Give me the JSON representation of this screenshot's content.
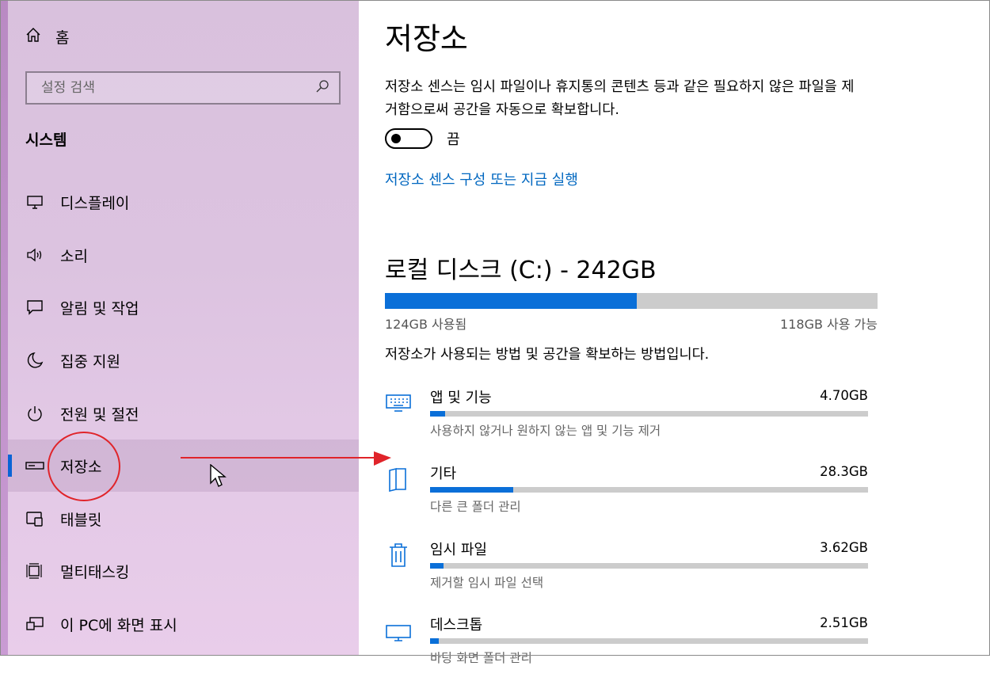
{
  "sidebar": {
    "home_label": "홈",
    "search_placeholder": "설정 검색",
    "section_title": "시스템",
    "items": [
      {
        "label": "디스플레이",
        "icon": "monitor-icon"
      },
      {
        "label": "소리",
        "icon": "speaker-icon"
      },
      {
        "label": "알림 및 작업",
        "icon": "notification-icon"
      },
      {
        "label": "집중 지원",
        "icon": "moon-icon"
      },
      {
        "label": "전원 및 절전",
        "icon": "power-icon"
      },
      {
        "label": "저장소",
        "icon": "storage-icon",
        "selected": true
      },
      {
        "label": "태블릿",
        "icon": "tablet-icon"
      },
      {
        "label": "멀티태스킹",
        "icon": "multitask-icon"
      },
      {
        "label": "이 PC에 화면 표시",
        "icon": "project-icon"
      }
    ]
  },
  "main": {
    "title": "저장소",
    "storage_sense_desc": "저장소 센스는 임시 파일이나 휴지통의 콘텐츠 등과 같은 필요하지 않은 파일을 제거함으로써 공간을 자동으로 확보합니다.",
    "toggle_state": "끔",
    "configure_link": "저장소 센스 구성 또는 지금 실행",
    "disk": {
      "title": "로컬 디스크 (C:) - 242GB",
      "used_label": "124GB 사용됨",
      "free_label": "118GB 사용 가능",
      "used_fraction": 0.512
    },
    "how_text": "저장소가 사용되는 방법 및 공간을 확보하는 방법입니다.",
    "categories": [
      {
        "name": "앱 및 기능",
        "size": "4.70GB",
        "desc": "사용하지 않거나 원하지 않는 앱 및 기능 제거",
        "fraction": 0.035,
        "icon": "keyboard-icon"
      },
      {
        "name": "기타",
        "size": "28.3GB",
        "desc": "다른 큰 폴더 관리",
        "fraction": 0.19,
        "icon": "folder-icon"
      },
      {
        "name": "임시 파일",
        "size": "3.62GB",
        "desc": "제거할 임시 파일 선택",
        "fraction": 0.03,
        "icon": "trash-icon"
      },
      {
        "name": "데스크톱",
        "size": "2.51GB",
        "desc": "바탕 화면 폴더 관리",
        "fraction": 0.02,
        "icon": "desktop-icon"
      }
    ]
  },
  "colors": {
    "accent": "#0a6fd8",
    "link": "#0067c0",
    "annotation": "#e0242a"
  }
}
